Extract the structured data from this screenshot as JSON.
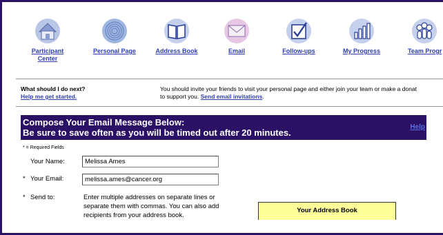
{
  "nav": {
    "items": [
      {
        "label_line1": "Participant",
        "label_line2": "Center",
        "icon": "house-icon"
      },
      {
        "label_line1": "Personal Page",
        "label_line2": "",
        "icon": "fingerprint-icon"
      },
      {
        "label_line1": "Address Book",
        "label_line2": "",
        "icon": "book-icon"
      },
      {
        "label_line1": "Email",
        "label_line2": "",
        "icon": "envelope-icon"
      },
      {
        "label_line1": "Follow-ups",
        "label_line2": "",
        "icon": "checkbox-icon"
      },
      {
        "label_line1": "My Progress",
        "label_line2": "",
        "icon": "bar-chart-icon"
      },
      {
        "label_line1": "Team Progr",
        "label_line2": "",
        "icon": "team-icon"
      }
    ]
  },
  "next": {
    "question": "What should I do next?",
    "help_link": "Help me get started.",
    "message_line1": "You should invite your friends to visit your personal page and either join your team or make a donat",
    "message_line2_prefix": "to support you.",
    "message_link": "Send email invitations",
    "message_suffix": "."
  },
  "banner": {
    "line1": "Compose Your Email Message Below:",
    "line2": "Be sure to save often as you will be timed out after 20 minutes.",
    "help": "Help"
  },
  "form": {
    "required_note": "* = Required Fields",
    "name_label": "Your Name:",
    "name_value": "Melissa Ames",
    "email_label": "Your Email:",
    "email_value": "melissa.ames@cancer.org",
    "sendto_label": "Send to:",
    "sendto_help": "Enter multiple addresses on separate lines or separate them with commas. You can also add recipients from your address book.",
    "star": "*"
  },
  "address_book": {
    "title": "Your Address Book",
    "bg_color": "#ffff99"
  },
  "colors": {
    "brand": "#2b1166",
    "link": "#2f3fb0"
  }
}
